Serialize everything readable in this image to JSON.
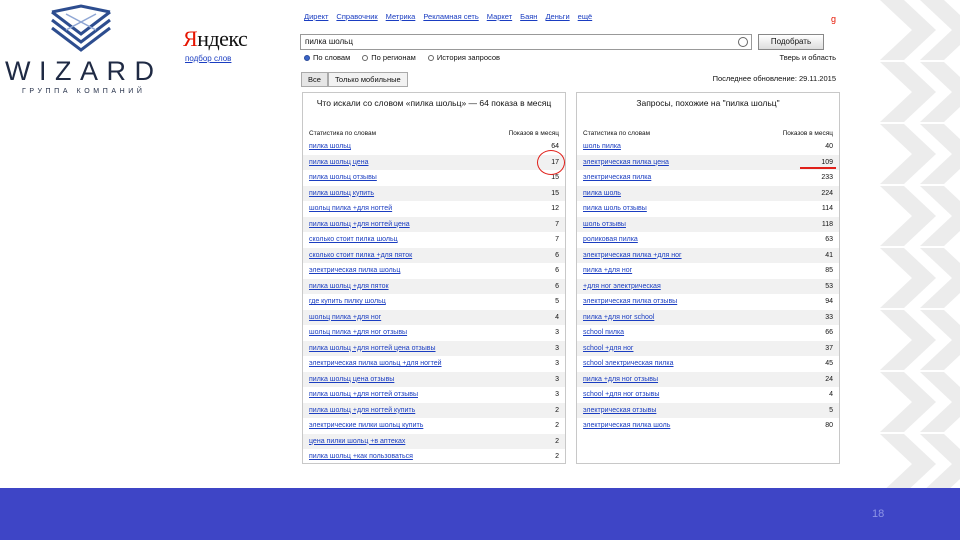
{
  "brand": {
    "name": "WIZARD",
    "subtitle": "ГРУППА КОМПАНИЙ",
    "color": "#1f2a44"
  },
  "yandex": {
    "logo": "Яндекс",
    "logo_first": "Я",
    "logo_rest": "ндекс",
    "service": "подбор слов"
  },
  "nav": [
    "Директ",
    "Справочник",
    "Метрика",
    "Рекламная сеть",
    "Маркет",
    "Баян",
    "Деньги",
    "ещё"
  ],
  "search": {
    "value": "пилка шольц",
    "button": "Подобрать",
    "options": [
      {
        "label": "По словам",
        "selected": true
      },
      {
        "label": "По регионам",
        "selected": false
      },
      {
        "label": "История запросов",
        "selected": false
      }
    ],
    "region": "Тверь и область"
  },
  "tabs": [
    {
      "label": "Все",
      "active": true
    },
    {
      "label": "Только мобильные",
      "active": false
    }
  ],
  "updated": "Последнее обновление: 29.11.2015",
  "left_panel": {
    "title": "Что искали со словом «пилка шольц» — 64 показа в месяц",
    "col_phrase": "Статистика по словам",
    "col_count": "Показов в месяц",
    "rows": [
      {
        "phrase": "пилка шольц",
        "count": "64"
      },
      {
        "phrase": "пилка шольц цена",
        "count": "17"
      },
      {
        "phrase": "пилка шольц отзывы",
        "count": "15"
      },
      {
        "phrase": "пилка шольц купить",
        "count": "15"
      },
      {
        "phrase": "шольц пилка +для ногтей",
        "count": "12"
      },
      {
        "phrase": "пилка шольц +для ногтей цена",
        "count": "7"
      },
      {
        "phrase": "сколько стоит пилка шольц",
        "count": "7"
      },
      {
        "phrase": "сколько стоит пилка +для пяток",
        "count": "6"
      },
      {
        "phrase": "электрическая пилка шольц",
        "count": "6"
      },
      {
        "phrase": "пилка шольц +для пяток",
        "count": "6"
      },
      {
        "phrase": "где купить пилку шольц",
        "count": "5"
      },
      {
        "phrase": "шольц пилка +для ног",
        "count": "4"
      },
      {
        "phrase": "шольц пилка +для ног отзывы",
        "count": "3"
      },
      {
        "phrase": "пилка шольц +для ногтей цена отзывы",
        "count": "3"
      },
      {
        "phrase": "электрическая пилка шольц +для ногтей",
        "count": "3"
      },
      {
        "phrase": "пилка шольц цена отзывы",
        "count": "3"
      },
      {
        "phrase": "пилка шольц +для ногтей отзывы",
        "count": "3"
      },
      {
        "phrase": "пилка шольц +для ногтей купить",
        "count": "2"
      },
      {
        "phrase": "электрические пилки шольц купить",
        "count": "2"
      },
      {
        "phrase": "цена пилки шольц +в аптеках",
        "count": "2"
      },
      {
        "phrase": "пилка шольц +как пользоваться",
        "count": "2"
      }
    ]
  },
  "right_panel": {
    "title": "Запросы, похожие на \"пилка шольц\"",
    "col_phrase": "Статистика по словам",
    "col_count": "Показов в месяц",
    "rows": [
      {
        "phrase": "шоль пилка",
        "count": "40"
      },
      {
        "phrase": "электрическая пилка цена",
        "count": "109"
      },
      {
        "phrase": "электрическая пилка",
        "count": "233"
      },
      {
        "phrase": "пилка шоль",
        "count": "224"
      },
      {
        "phrase": "пилка шоль отзывы",
        "count": "114"
      },
      {
        "phrase": "шоль отзывы",
        "count": "118"
      },
      {
        "phrase": "роликовая пилка",
        "count": "63"
      },
      {
        "phrase": "электрическая пилка +для ног",
        "count": "41"
      },
      {
        "phrase": "пилка +для ног",
        "count": "85"
      },
      {
        "phrase": "+для ног электрическая",
        "count": "53"
      },
      {
        "phrase": "электрическая пилка отзывы",
        "count": "94"
      },
      {
        "phrase": "пилка +для ног school",
        "count": "33"
      },
      {
        "phrase": "school пилка",
        "count": "66"
      },
      {
        "phrase": "school +для ног",
        "count": "37"
      },
      {
        "phrase": "school электрическая пилка",
        "count": "45"
      },
      {
        "phrase": "пилка +для ног отзывы",
        "count": "24"
      },
      {
        "phrase": "school +для ног отзывы",
        "count": "4"
      },
      {
        "phrase": "электрическая отзывы",
        "count": "5"
      },
      {
        "phrase": "электрическая пилка шоль",
        "count": "80"
      }
    ]
  },
  "page_number": "18",
  "colors": {
    "footer": "#3e45c6",
    "link": "#1a3dc1",
    "annotation": "#e0201a"
  }
}
